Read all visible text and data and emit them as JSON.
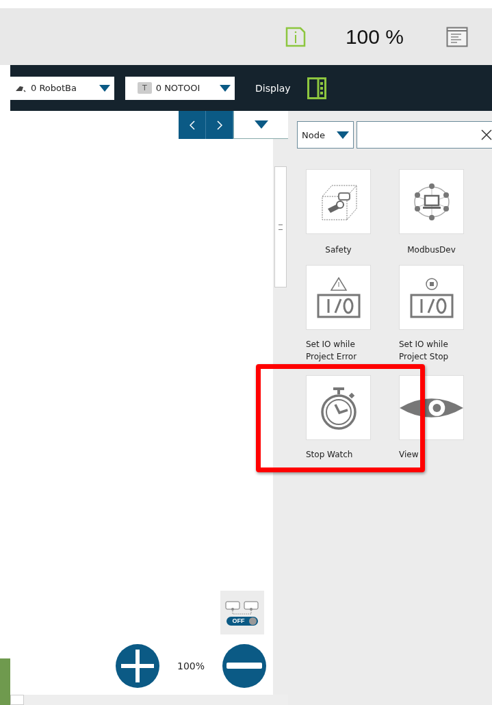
{
  "header": {
    "zoom": "100 %"
  },
  "toolbar": {
    "items": [
      {
        "kind": "base",
        "label": "0 RobotBa"
      },
      {
        "kind": "tool",
        "label": "0 NOTOOI",
        "badge": "T"
      }
    ],
    "display": "Display"
  },
  "canvas": {
    "zoom_level": "100%",
    "link_toggle": {
      "label": "OFF",
      "on": false
    }
  },
  "panel": {
    "filter": "Node",
    "nodes": [
      {
        "label": "Safety",
        "kind": "safety",
        "highlighted": false
      },
      {
        "label": "ModbusDev",
        "kind": "network",
        "highlighted": false
      },
      {
        "label": "Set IO while Project Error",
        "kind": "ioerror",
        "highlighted": false
      },
      {
        "label": "Set IO while Project Stop",
        "kind": "iostop",
        "highlighted": false
      },
      {
        "label": "Stop Watch",
        "kind": "stopwatch",
        "highlighted": true
      },
      {
        "label": "View",
        "kind": "eye",
        "highlighted": false
      }
    ]
  }
}
